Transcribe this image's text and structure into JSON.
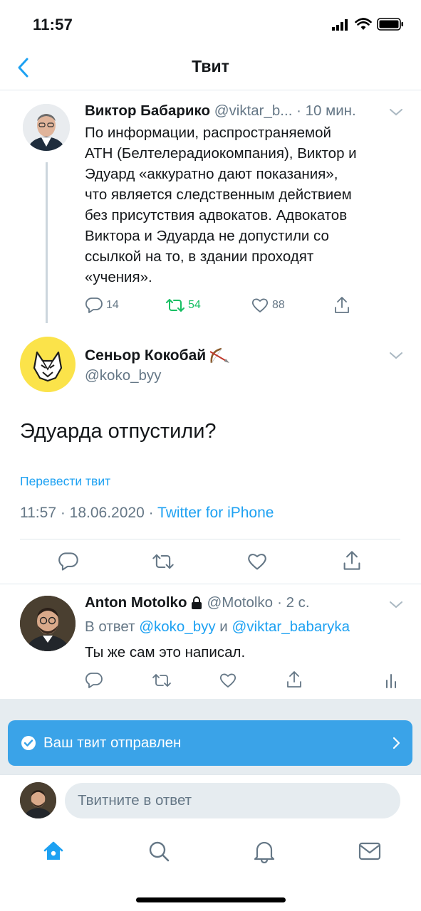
{
  "status_bar": {
    "time": "11:57"
  },
  "header": {
    "title": "Твит"
  },
  "parent_tweet": {
    "name": "Виктор Бабарико",
    "handle": "@viktar_b...",
    "time": "· 10 мин.",
    "lines": [
      "По информации, распространяемой",
      "АТН (Белтелерадиокомпания), Виктор и",
      "Эдуард «аккуратно дают показания»,",
      "что является следственным действием",
      "без присутствия адвокатов. Адвокатов",
      "Виктора и Эдуарда не допустили со",
      "ссылкой на то, в здании проходят",
      "«учения»."
    ],
    "replies": "14",
    "retweets": "54",
    "likes": "88"
  },
  "main_tweet": {
    "name": "Сеньор Кокобай",
    "handle": "@koko_byy",
    "text": "Эдуарда отпустили?",
    "translate": "Перевести твит",
    "timestamp": "11:57 · 18.06.2020 · ",
    "source": "Twitter for iPhone"
  },
  "reply_tweet": {
    "name": "Anton Motolko",
    "handle": "@Motolko",
    "time": "· 2 с.",
    "reply_prefix": "В ответ ",
    "reply_user1": "@koko_byy",
    "reply_and": " и ",
    "reply_user2": "@viktar_babaryka",
    "text": "Ты же сам это написал."
  },
  "toast": {
    "text": "Ваш твит отправлен"
  },
  "composer": {
    "placeholder": "Твитните в ответ"
  },
  "colors": {
    "accent": "#1da1f2",
    "retweet_green": "#17bf63",
    "text_muted": "#657786",
    "toast_bg": "#3aa3e8"
  }
}
